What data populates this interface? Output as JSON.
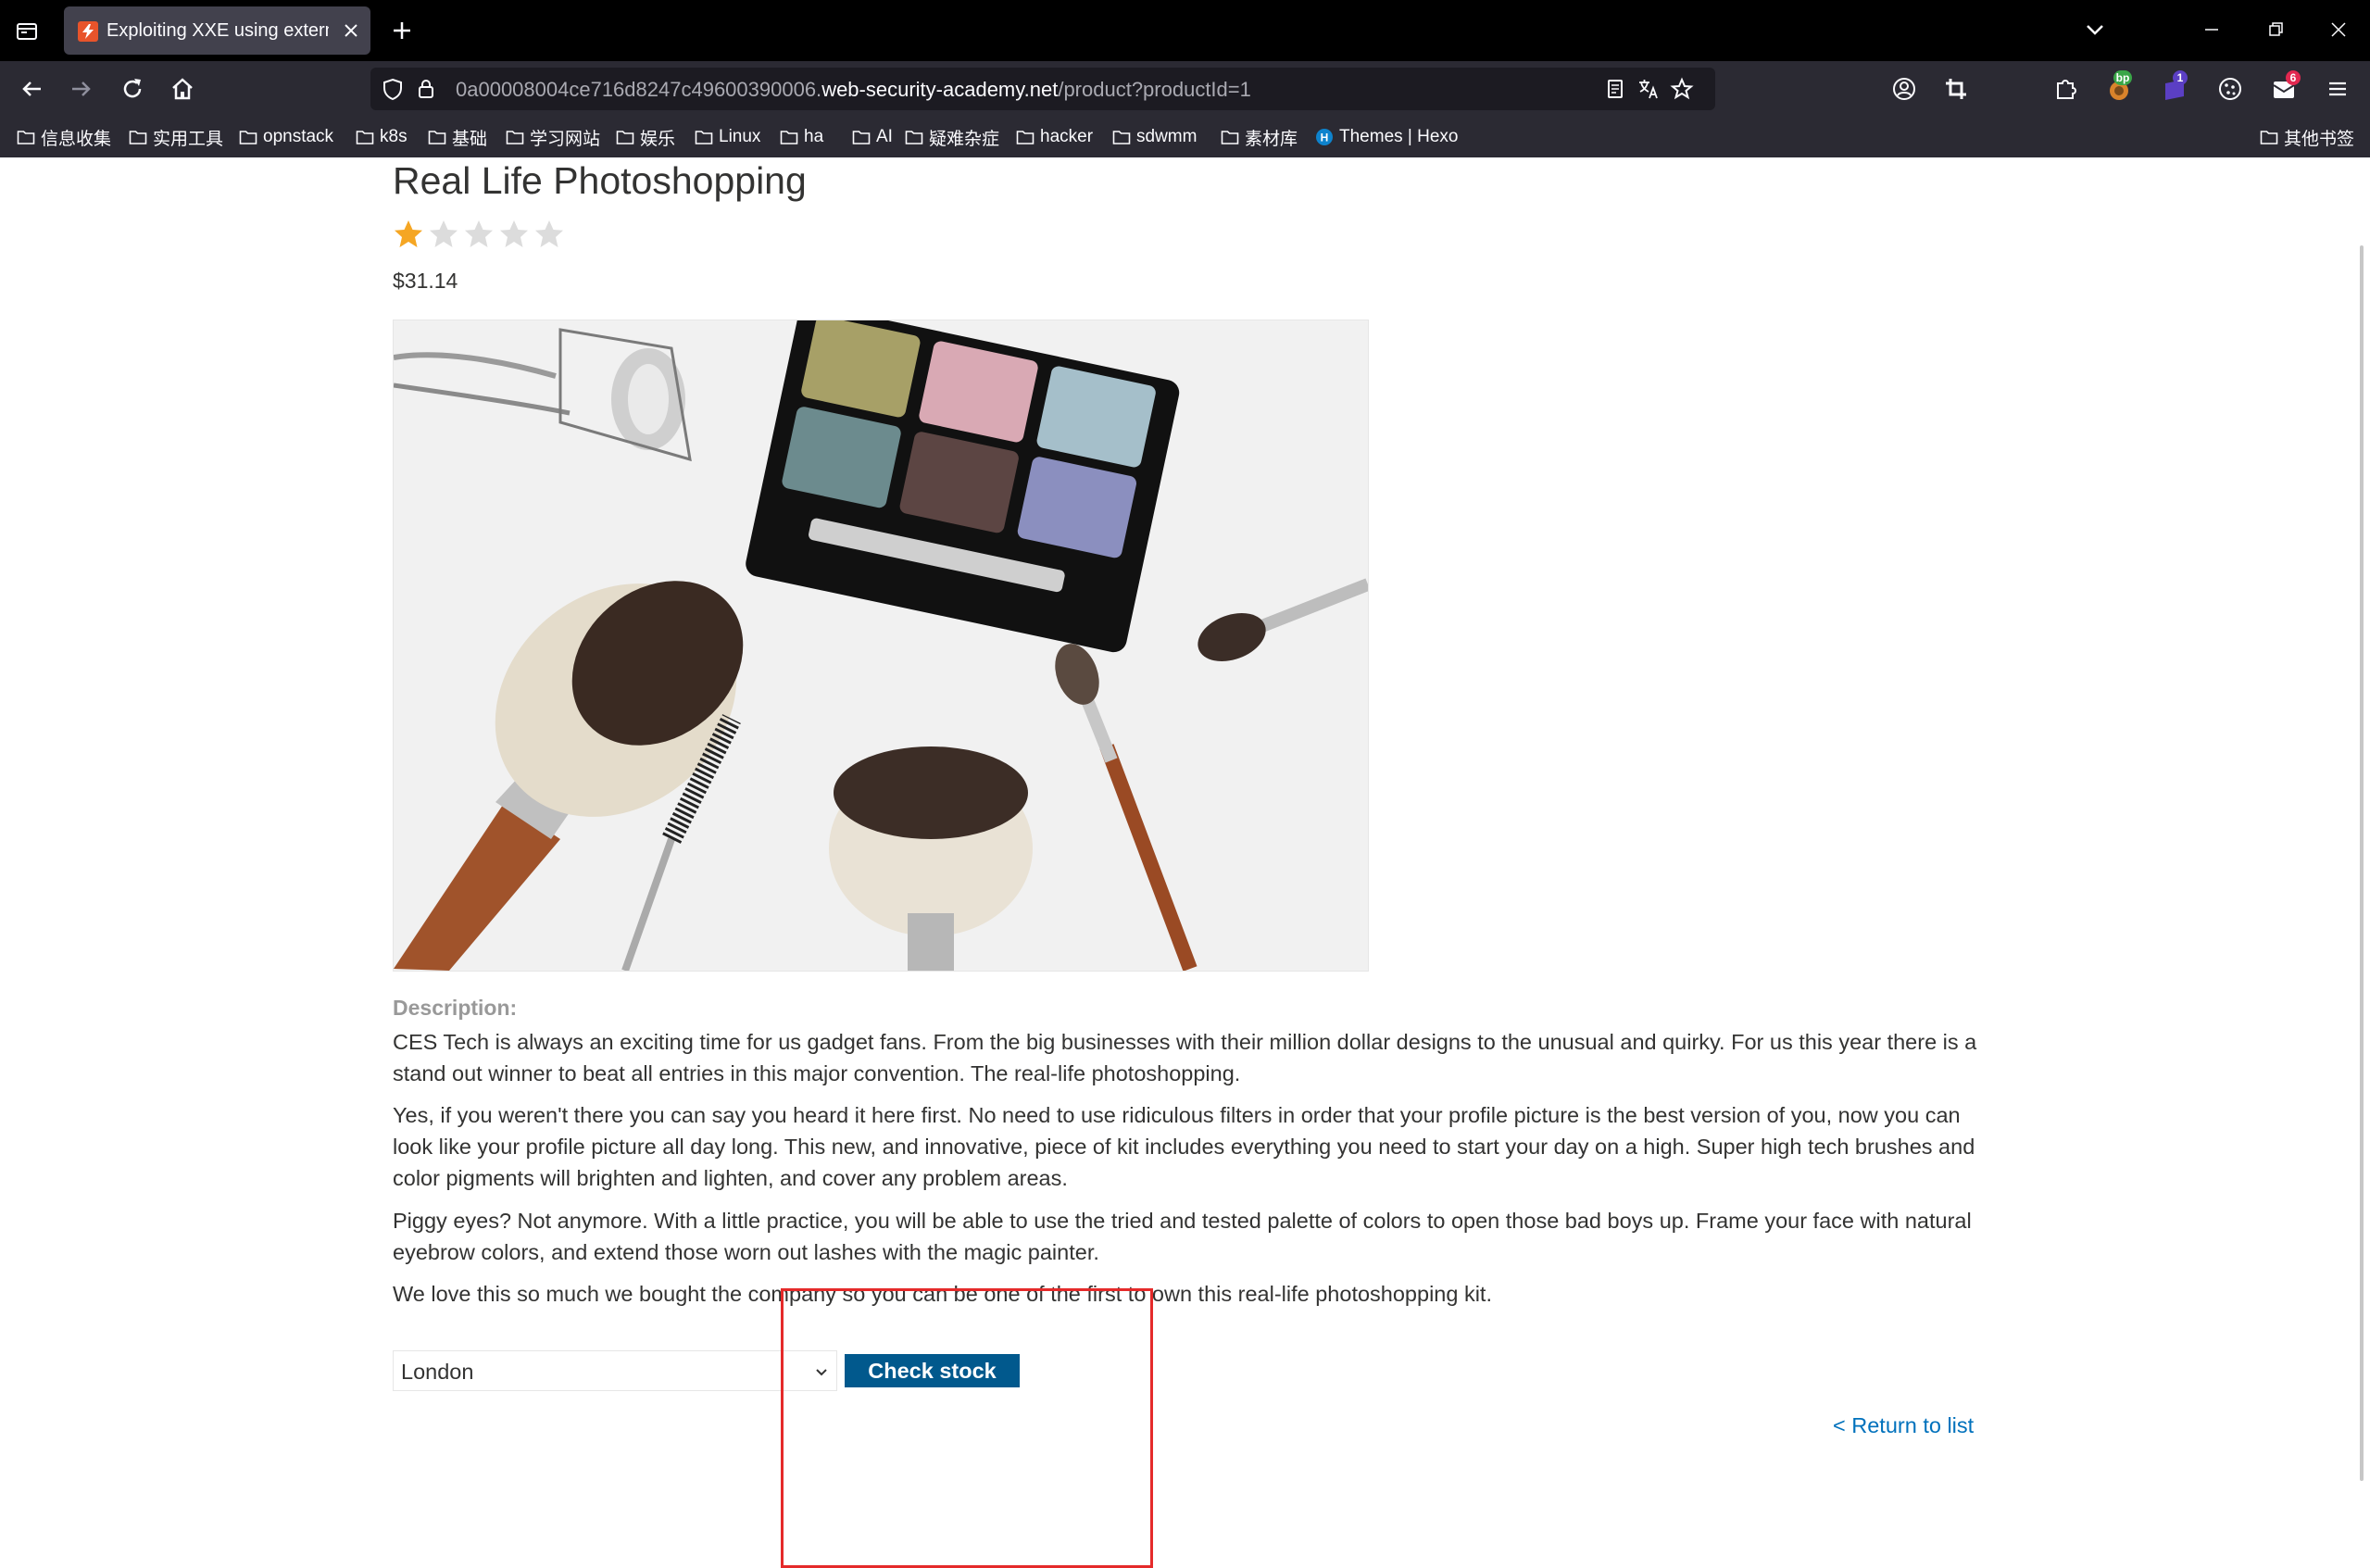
{
  "browser": {
    "tab": {
      "title": "Exploiting XXE using external",
      "favicon": "lightning-favicon-icon"
    },
    "url": {
      "prefix": "0a00008004ce716d8247c49600390006.",
      "host": "web-security-academy.net",
      "path": "/product?productId=1"
    },
    "toolbar_badges": {
      "burp": "bp",
      "purple": "1",
      "mail": "6"
    },
    "bookmarks": [
      "信息收集",
      "实用工具",
      "opnstack",
      "k8s",
      "基础",
      "学习网站",
      "娱乐",
      "Linux",
      "ha",
      "AI",
      "疑难杂症",
      "hacker",
      "sdwmm",
      "素材库"
    ],
    "hexo_bookmark": "Themes | Hexo",
    "other_bookmarks": "其他书签"
  },
  "product": {
    "title": "Real Life Photoshopping",
    "rating": 1,
    "rating_max": 5,
    "price": "$31.14",
    "description_label": "Description:",
    "paragraphs": [
      "CES Tech is always an exciting time for us gadget fans. From the big businesses with their million dollar designs to the unusual and quirky. For us this year there is a stand out winner to beat all entries in this major convention. The real-life photoshopping.",
      "Yes, if you weren't there you can say you heard it here first. No need to use ridiculous filters in order that your profile picture is the best version of you, now you can look like your profile picture all day long. This new, and innovative, piece of kit includes everything you need to start your day on a high. Super high tech brushes and color pigments will brighten and lighten, and cover any problem areas.",
      "Piggy eyes? Not anymore. With a little practice, you will be able to use the tried and tested palette of colors to open those bad boys up. Frame your face with natural eyebrow colors, and extend those worn out lashes with the magic painter.",
      "We love this so much we bought the company so you can be one of the first to own this real-life photoshopping kit."
    ]
  },
  "stock": {
    "selected_store": "London",
    "button_label": "Check stock"
  },
  "return_link": "< Return to list",
  "colors": {
    "button": "#01598d",
    "link": "#0071bc",
    "highlight": "#e52a2a",
    "star_filled": "#f5a623",
    "star_empty": "#dcdcdc"
  }
}
